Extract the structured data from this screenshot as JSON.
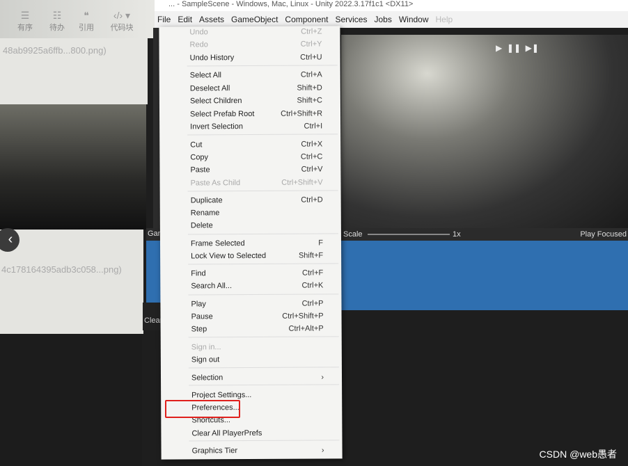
{
  "editor_toolbar": [
    {
      "icon": "ordered-list-icon",
      "label": "有序"
    },
    {
      "icon": "todo-list-icon",
      "label": "待办"
    },
    {
      "icon": "quote-icon",
      "label": "引用"
    },
    {
      "icon": "code-block-icon",
      "label": "代码块"
    }
  ],
  "background_files": [
    "48ab9925a6ffb...800.png)",
    "4c178164395adb3c058...png)"
  ],
  "window_title": "... - SampleScene - Windows, Mac, Linux - Unity 2022.3.17f1c1 <DX11>",
  "menubar": [
    "File",
    "Edit",
    "Assets",
    "GameObject",
    "Component",
    "Services",
    "Jobs",
    "Window",
    "Help"
  ],
  "game_bar": {
    "tab": "Game",
    "scale_label": "Scale",
    "scale_value": "1x",
    "play_focused": "Play Focused"
  },
  "console": {
    "clear": "Clear"
  },
  "edit_menu": [
    {
      "label": "Undo",
      "shortcut": "Ctrl+Z",
      "disabled": true
    },
    {
      "label": "Redo",
      "shortcut": "Ctrl+Y",
      "disabled": true
    },
    {
      "label": "Undo History",
      "shortcut": "Ctrl+U"
    },
    {
      "label": "Select All",
      "shortcut": "Ctrl+A"
    },
    {
      "label": "Deselect All",
      "shortcut": "Shift+D"
    },
    {
      "label": "Select Children",
      "shortcut": "Shift+C"
    },
    {
      "label": "Select Prefab Root",
      "shortcut": "Ctrl+Shift+R"
    },
    {
      "label": "Invert Selection",
      "shortcut": "Ctrl+I"
    },
    {
      "label": "Cut",
      "shortcut": "Ctrl+X"
    },
    {
      "label": "Copy",
      "shortcut": "Ctrl+C"
    },
    {
      "label": "Paste",
      "shortcut": "Ctrl+V"
    },
    {
      "label": "Paste As Child",
      "shortcut": "Ctrl+Shift+V",
      "disabled": true
    },
    {
      "label": "Duplicate",
      "shortcut": "Ctrl+D"
    },
    {
      "label": "Rename",
      "shortcut": ""
    },
    {
      "label": "Delete",
      "shortcut": ""
    },
    {
      "label": "Frame Selected",
      "shortcut": "F"
    },
    {
      "label": "Lock View to Selected",
      "shortcut": "Shift+F"
    },
    {
      "label": "Find",
      "shortcut": "Ctrl+F"
    },
    {
      "label": "Search All...",
      "shortcut": "Ctrl+K"
    },
    {
      "label": "Play",
      "shortcut": "Ctrl+P"
    },
    {
      "label": "Pause",
      "shortcut": "Ctrl+Shift+P"
    },
    {
      "label": "Step",
      "shortcut": "Ctrl+Alt+P"
    },
    {
      "label": "Sign in...",
      "shortcut": "",
      "disabled": true
    },
    {
      "label": "Sign out",
      "shortcut": ""
    },
    {
      "label": "Selection",
      "shortcut": "›"
    },
    {
      "label": "Project Settings...",
      "shortcut": ""
    },
    {
      "label": "Preferences...",
      "shortcut": ""
    },
    {
      "label": "Shortcuts...",
      "shortcut": ""
    },
    {
      "label": "Clear All PlayerPrefs",
      "shortcut": ""
    },
    {
      "label": "Graphics Tier",
      "shortcut": "›"
    }
  ],
  "highlight_color": "#e0201c",
  "watermark": "CSDN @web愚者"
}
